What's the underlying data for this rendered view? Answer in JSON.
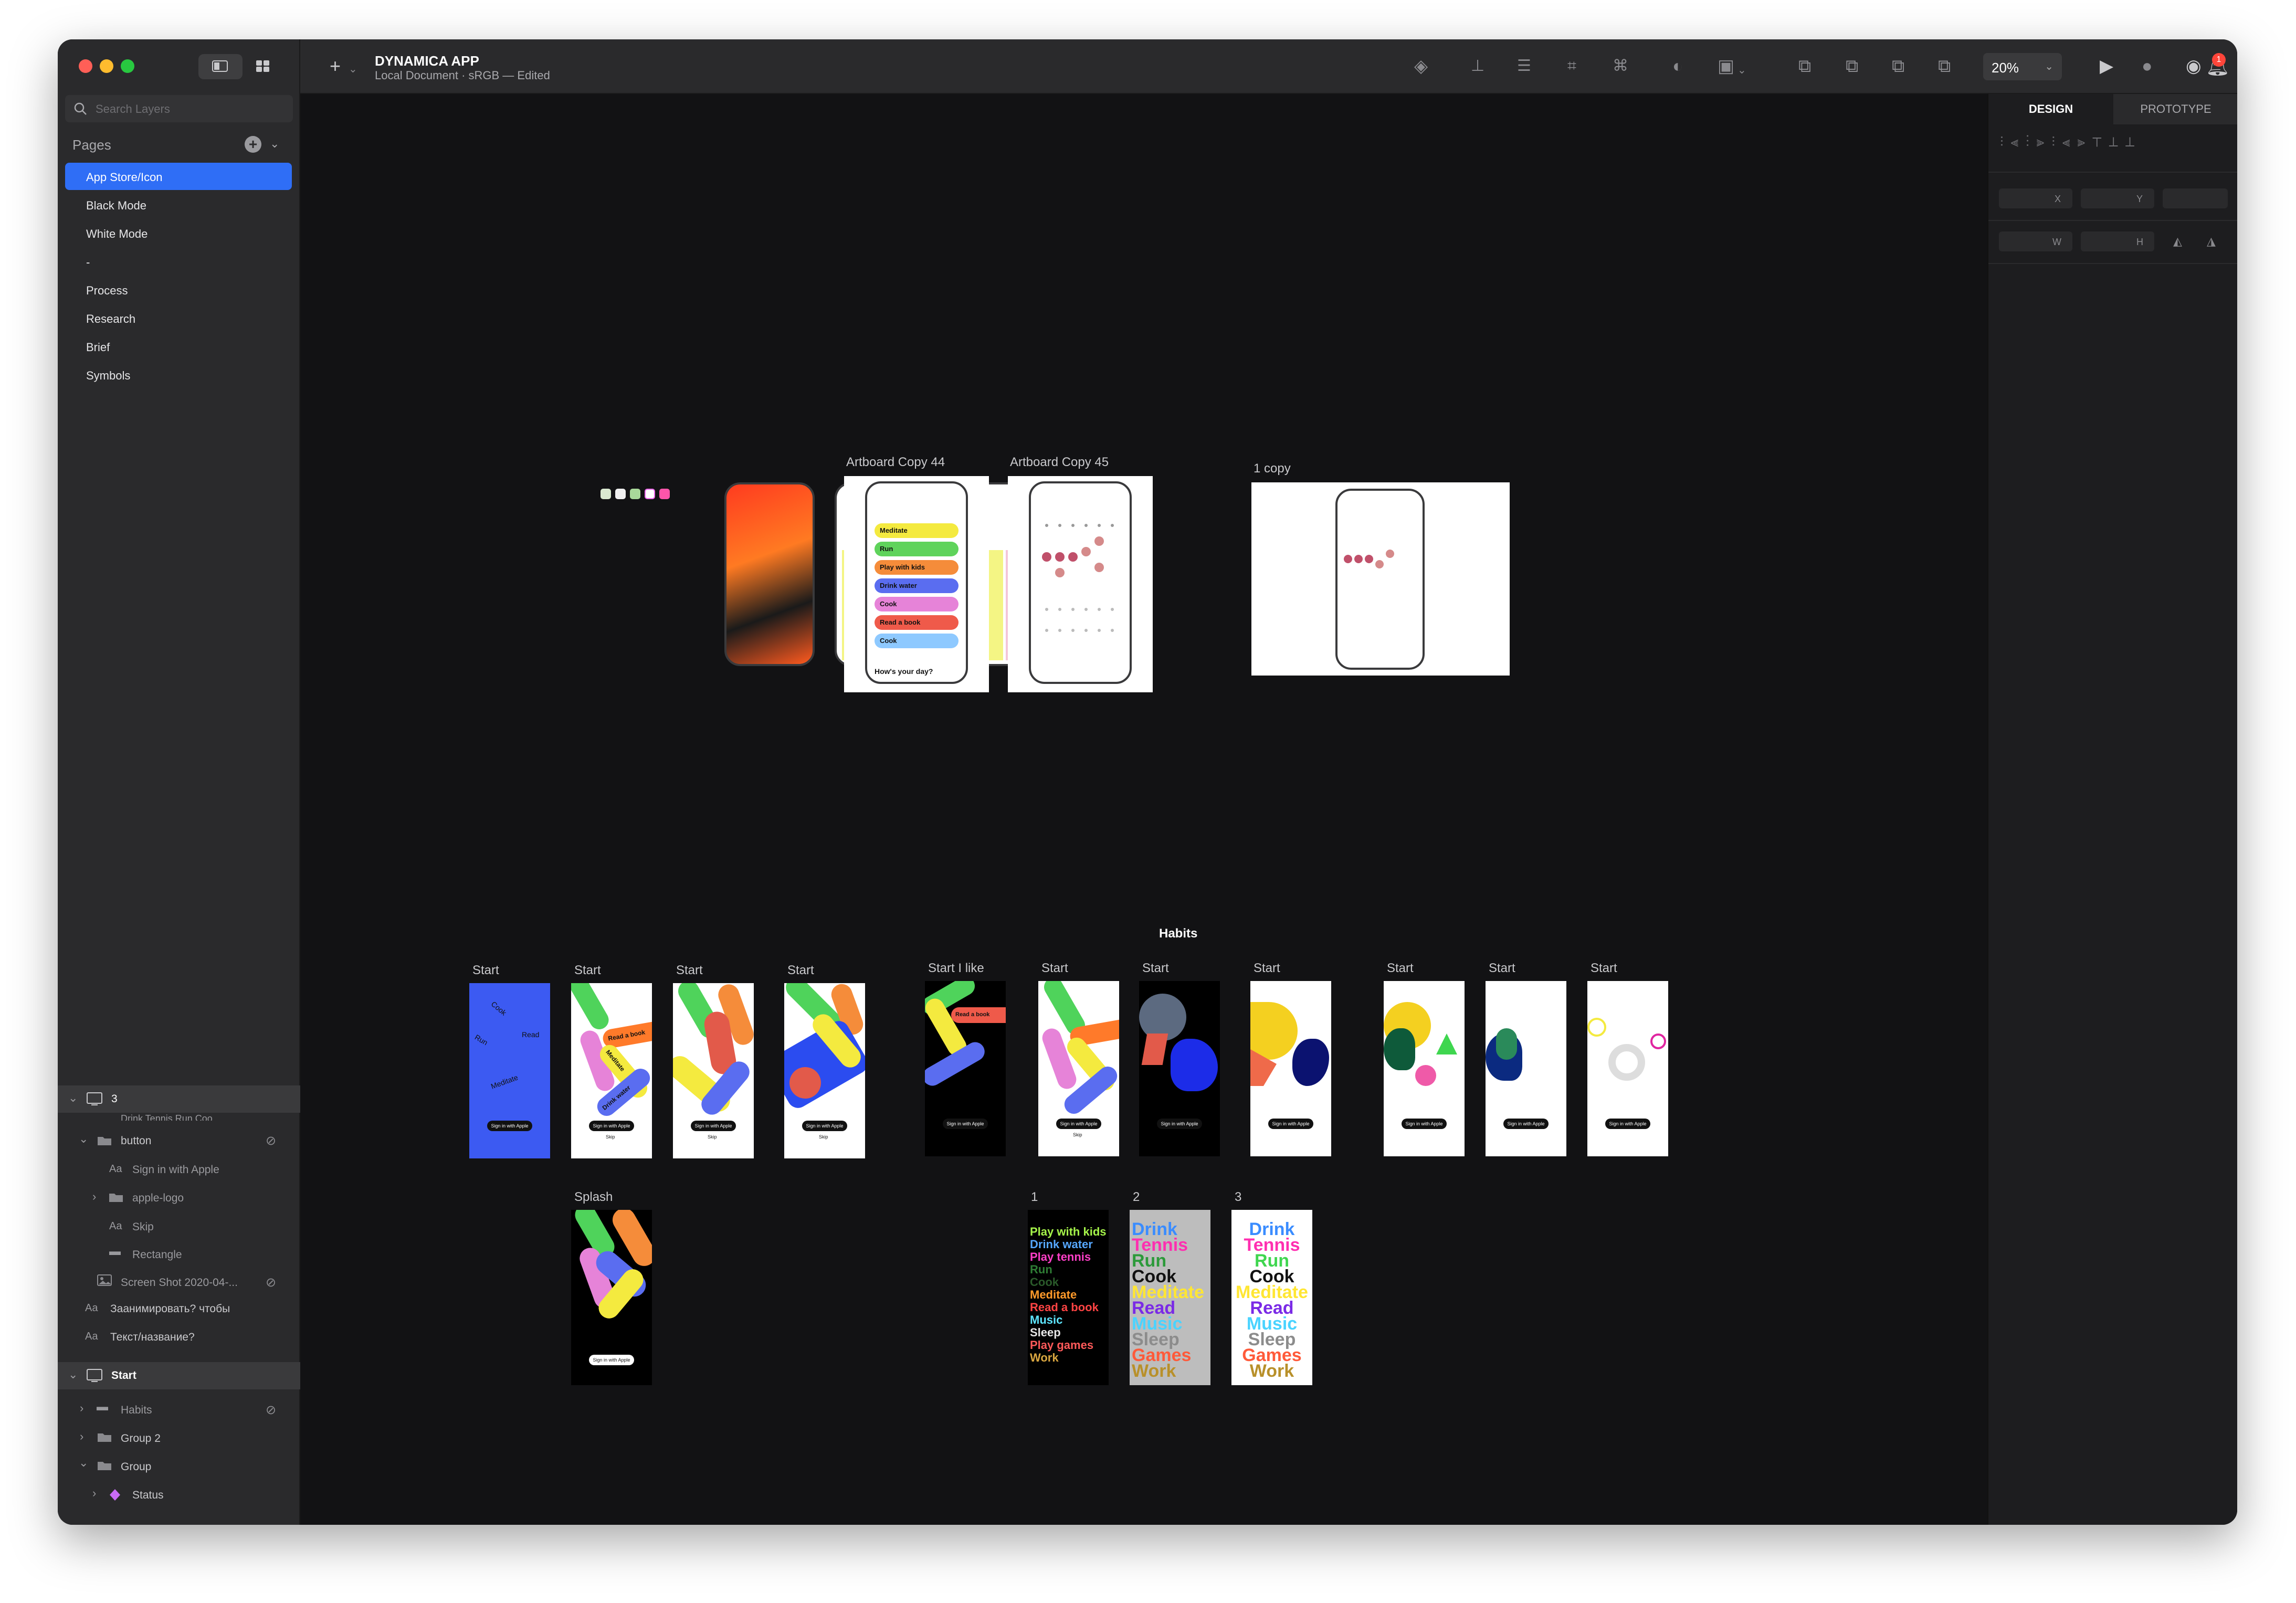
{
  "window": {
    "title": "DYNAMICA APP",
    "subtitle": "Local Document · sRGB — Edited"
  },
  "search": {
    "placeholder": "Search Layers"
  },
  "pages": {
    "header": "Pages",
    "items": [
      {
        "label": "App Store/Icon",
        "active": true
      },
      {
        "label": "Black Mode"
      },
      {
        "label": "White Mode"
      },
      {
        "label": "-"
      },
      {
        "label": "Process"
      },
      {
        "label": "Research"
      },
      {
        "label": "Brief"
      },
      {
        "label": "Symbols"
      }
    ]
  },
  "layers": {
    "group3": "3",
    "cut": "Drink Tennis Run Coo",
    "button": "button",
    "sign_in": "Sign in with Apple",
    "apple_logo": "apple-logo",
    "skip": "Skip",
    "rectangle": "Rectangle",
    "screenshot": "Screen Shot 2020-04-...",
    "ru1": "Заанимировать? чтобы",
    "ru2": "Текст/название?",
    "start": "Start",
    "habits": "Habits",
    "group2": "Group 2",
    "group": "Group",
    "status": "Status"
  },
  "toolbar": {
    "zoom": "20%",
    "notifications": "1"
  },
  "inspector": {
    "tab_design": "DESIGN",
    "tab_prototype": "PROTOTYPE",
    "x": "X",
    "y": "Y",
    "w": "W",
    "h": "H"
  },
  "canvas": {
    "habits_title": "Habits",
    "artboard44": "Artboard Copy 44",
    "artboard45": "Artboard Copy 45",
    "copy1": "1 copy",
    "start": "Start",
    "start_i_like": "Start I like",
    "splash": "Splash",
    "n1": "1",
    "n2": "2",
    "n3": "3",
    "signin_btn": "Sign in with Apple",
    "skip": "Skip",
    "habit_list": [
      {
        "label": "Meditate",
        "color": "#f4ea3f"
      },
      {
        "label": "Run",
        "color": "#5fd35b"
      },
      {
        "label": "Play with kids",
        "color": "#f58c3a"
      },
      {
        "label": "Drink water",
        "color": "#5a6df0"
      },
      {
        "label": "Cook",
        "color": "#e683d8"
      },
      {
        "label": "Read a book",
        "color": "#ef5a4a"
      },
      {
        "label": "Cook",
        "color": "#8ec9ff"
      }
    ],
    "habit_question": "How's your day?",
    "poster1": [
      {
        "t": "Play with kids",
        "c": "#a6f54a"
      },
      {
        "t": "Drink water",
        "c": "#56a8ff"
      },
      {
        "t": "Play tennis",
        "c": "#ff3fc8"
      },
      {
        "t": "Run",
        "c": "#2f7d35"
      },
      {
        "t": "Cook",
        "c": "#2a5a2a"
      },
      {
        "t": "Meditate",
        "c": "#ff9a2a"
      },
      {
        "t": "Read a book",
        "c": "#ff4444"
      },
      {
        "t": "Music",
        "c": "#5ee6ff"
      },
      {
        "t": "Sleep",
        "c": "#e6e6e6"
      },
      {
        "t": "Play games",
        "c": "#ff5a5a"
      },
      {
        "t": "Work",
        "c": "#d9a640"
      }
    ],
    "poster2": [
      {
        "t": "Drink",
        "c": "#3a8cff"
      },
      {
        "t": "Tennis",
        "c": "#ff2fb0"
      },
      {
        "t": "Run",
        "c": "#2c9a3a"
      },
      {
        "t": "Cook",
        "c": "#111111"
      },
      {
        "t": "Meditate",
        "c": "#ffe633"
      },
      {
        "t": "Read",
        "c": "#7a2ae6"
      },
      {
        "t": "Music",
        "c": "#4ad3ff"
      },
      {
        "t": "Sleep",
        "c": "#8c8c8c"
      },
      {
        "t": "Games",
        "c": "#ff5a3a"
      },
      {
        "t": "Work",
        "c": "#b8902a"
      }
    ],
    "poster3": [
      {
        "t": "Drink",
        "c": "#3a8cff"
      },
      {
        "t": "Tennis",
        "c": "#ff2fb0"
      },
      {
        "t": "Run",
        "c": "#3fd64f"
      },
      {
        "t": "Cook",
        "c": "#111111"
      },
      {
        "t": "Meditate",
        "c": "#ffe633"
      },
      {
        "t": "Read",
        "c": "#7a2ae6"
      },
      {
        "t": "Music",
        "c": "#4ad3ff"
      },
      {
        "t": "Sleep",
        "c": "#8c8c8c"
      },
      {
        "t": "Games",
        "c": "#ff5a3a"
      },
      {
        "t": "Work",
        "c": "#b8902a"
      }
    ],
    "pill_words": [
      "Cook",
      "Read",
      "Run",
      "Meditate",
      "Drink water",
      "Read a book"
    ]
  }
}
